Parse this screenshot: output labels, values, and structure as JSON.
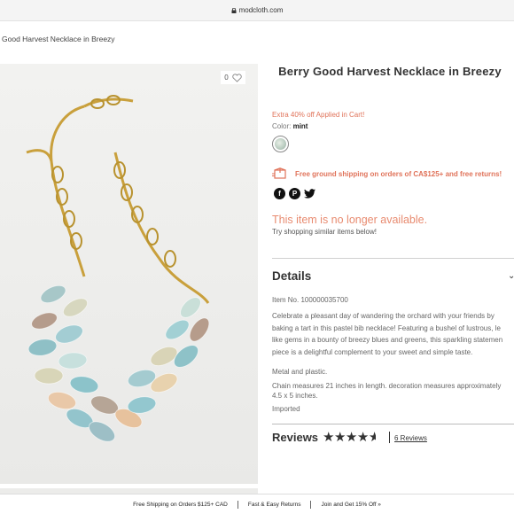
{
  "browser": {
    "url": "modcloth.com"
  },
  "breadcrumb": "Good Harvest Necklace in Breezy",
  "product": {
    "favorites_count": "0",
    "title": "Berry Good Harvest Necklace in Breezy",
    "promo": "Extra 40% off Applied in Cart!",
    "color_label": "Color:",
    "color_value": "mint",
    "shipping_note": "Free ground shipping on orders of CA$125+ and free returns!",
    "unavailable": "This item is no longer available.",
    "similar": "Try shopping similar items below!"
  },
  "details": {
    "heading": "Details",
    "item_no": "Item No. 100000035700",
    "description_lines": [
      "Celebrate a pleasant day of wandering the orchard with your friends by",
      "baking a tart in this pastel bib necklace! Featuring a bushel of lustrous, le",
      "like gems in a bounty of breezy blues and greens, this sparkling statemen",
      "piece is a delightful complement to your sweet and simple taste."
    ],
    "material": "Metal and plastic.",
    "chain_lines": [
      "Chain measures 21 inches in length. decoration measures approximately",
      "4.5 x 5 inches."
    ],
    "origin": "Imported"
  },
  "reviews": {
    "heading": "Reviews",
    "rating": 4.5,
    "link": "6 Reviews"
  },
  "footer": {
    "items": [
      "Free Shipping on Orders $125+ CAD",
      "Fast & Easy Returns",
      "Join and Get 15% Off »"
    ]
  },
  "colors": {
    "accent": "#e0735a",
    "text": "#333333"
  },
  "icons": [
    "lock-icon",
    "heart-icon",
    "truck-box-icon",
    "facebook-icon",
    "pinterest-icon",
    "twitter-icon",
    "chevron-down-icon",
    "star-icon"
  ]
}
